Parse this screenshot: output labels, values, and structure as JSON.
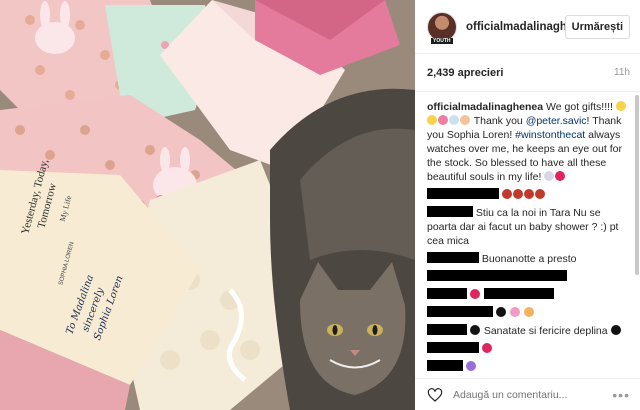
{
  "post": {
    "username": "officialmadalinaghenea",
    "avatar_badge": "YOUTH",
    "follow_label": "Urmărești",
    "likes": "2,439 aprecieri",
    "time": "11h",
    "add_comment_placeholder": "Adaugă un comentariu...",
    "more_label": "•••"
  },
  "caption": {
    "user": "officialmadalinaghenea",
    "part1": "We got gifts!!!!",
    "part2": "Thank you",
    "mention1": "@peter.savic",
    "part3": "! Thank you Sophia Loren!",
    "hashtag": "#winstonthecat",
    "part4": "always watches over me, he keeps an eye out for the stock. So blessed to have all these beautiful souls in my life!"
  },
  "comments": [
    {
      "text": ""
    },
    {
      "text": "Stiu ca la noi in Tara Nu se poarta dar ai facut un baby shower ? :) pt cea mica"
    },
    {
      "text": "Buonanotte a presto"
    },
    {
      "text": ""
    },
    {
      "text": ""
    },
    {
      "text": "Sanatate si fericire deplina"
    },
    {
      "text": ""
    },
    {
      "text": ""
    }
  ],
  "photo": {
    "book_title_line1": "Yesterday, Today,",
    "book_title_line2": "Tomorrow",
    "book_subtitle": "My Life",
    "book_author": "SOPHIA LOREN",
    "handwriting_line1": "To Madalina",
    "handwriting_line2": "sincerely",
    "handwriting_line3": "Sophia Loren"
  },
  "colors": {
    "accent_blue": "#003569",
    "heart_red": "#e0245e"
  }
}
